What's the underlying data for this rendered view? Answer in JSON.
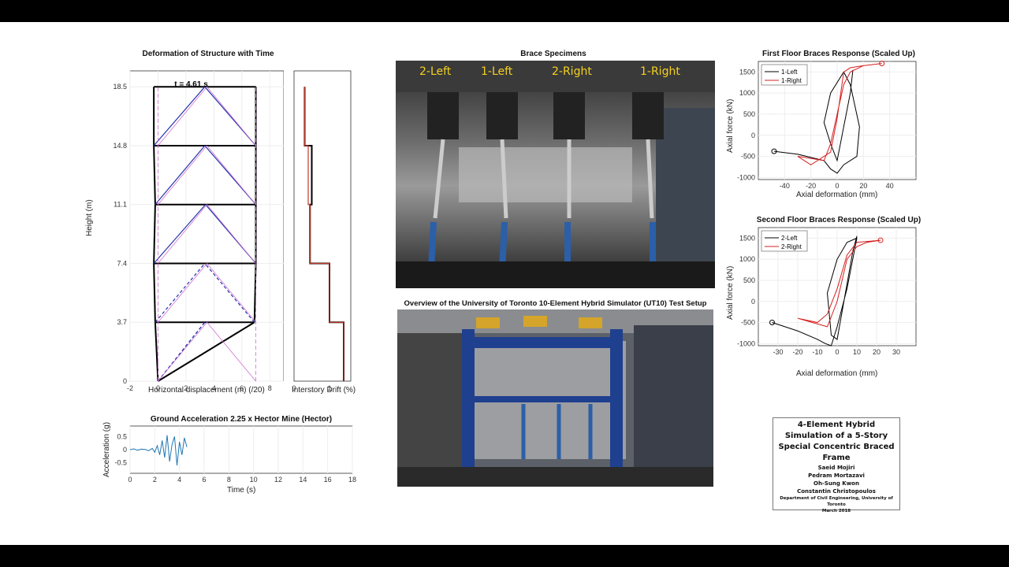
{
  "panels": {
    "deformation": {
      "title": "Deformation of Structure with Time",
      "time_label": "t =  4.61 s",
      "xlabel": "Horizontal displacement (m) (/20)",
      "ylabel": "Height (m)",
      "xticks": [
        "-2",
        "0",
        "2",
        "4",
        "6",
        "8"
      ],
      "yticks": [
        "0",
        "3.7",
        "7.4",
        "11.1",
        "14.8",
        "18.5"
      ]
    },
    "drift": {
      "xlabel": "Interstory Drift (%)",
      "xticks": [
        "0",
        "1"
      ]
    },
    "ground": {
      "title": "Ground Acceleration 2.25 x Hector Mine (Hector)",
      "xlabel": "Time (s)",
      "ylabel": "Acceleration (g)",
      "xticks": [
        "0",
        "2",
        "4",
        "6",
        "8",
        "10",
        "12",
        "14",
        "16",
        "18"
      ],
      "yticks": [
        "0.5",
        "0",
        "-0.5"
      ]
    },
    "brace_photo": {
      "title": "Brace Specimens",
      "labels": [
        "2-Left",
        "1-Left",
        "2-Right",
        "1-Right"
      ]
    },
    "setup_photo": {
      "title": "Overview of the University of Toronto 10-Element Hybrid Simulator (UT10) Test Setup"
    },
    "floor1": {
      "title": "First Floor Braces Response (Scaled Up)",
      "xlabel": "Axial deformation (mm)",
      "ylabel": "Axial force (kN)",
      "xticks": [
        "-40",
        "-20",
        "0",
        "20",
        "40"
      ],
      "yticks": [
        "1500",
        "1000",
        "500",
        "0",
        "-500",
        "-1000"
      ],
      "legend": [
        "1-Left",
        "1-Right"
      ]
    },
    "floor2": {
      "title": "Second Floor Braces Response (Scaled Up)",
      "xlabel": "Axial deformation (mm)",
      "ylabel": "Axial force (kN)",
      "xticks": [
        "-30",
        "-20",
        "-10",
        "0",
        "10",
        "20",
        "30"
      ],
      "yticks": [
        "1500",
        "1000",
        "500",
        "0",
        "-500",
        "-1000"
      ],
      "legend": [
        "2-Left",
        "2-Right"
      ]
    }
  },
  "credit": {
    "title": "4-Element Hybrid Simulation of a 5-Story Special Concentric Braced Frame",
    "authors": [
      "Saeid Mojiri",
      "Pedram Mortazavi",
      "Oh-Sung Kwon",
      "Constantin Christopoulos"
    ],
    "department": "Department of Civil Engineering, University of Toronto",
    "date": "March 2018"
  },
  "colors": {
    "left": "#000000",
    "right": "#d62020",
    "frame": "#000000",
    "brace": "#2233aa",
    "ghost": "#d070d0",
    "accel": "#1f77b4",
    "drift": "#c0392b"
  },
  "chart_data": [
    {
      "type": "line",
      "name": "deformation",
      "xlim": [
        -2,
        9
      ],
      "ylim": [
        0,
        19.5
      ],
      "story_heights": [
        0,
        3.7,
        7.4,
        11.1,
        14.8,
        18.5
      ],
      "floor_displacement": [
        0,
        6.9,
        7.0,
        7.0,
        7.0,
        7.0
      ],
      "floor_displacement_left": [
        0,
        -0.2,
        -0.3,
        -0.2,
        -0.3,
        -0.3
      ]
    },
    {
      "type": "line",
      "name": "drift",
      "xlim": [
        0,
        1.6
      ],
      "ylim": [
        0,
        19.5
      ],
      "current_drift": [
        1.4,
        1.0,
        0.45,
        0.4,
        0.3
      ],
      "peak_drift": [
        1.4,
        1.0,
        0.45,
        0.5,
        0.3
      ]
    },
    {
      "type": "line",
      "name": "ground",
      "xlim": [
        0,
        18
      ],
      "ylim": [
        -0.9,
        0.9
      ],
      "x": [
        0,
        0.3,
        0.6,
        0.9,
        1.2,
        1.5,
        1.8,
        2.0,
        2.2,
        2.4,
        2.6,
        2.8,
        3.0,
        3.2,
        3.4,
        3.6,
        3.8,
        4.0,
        4.2,
        4.4,
        4.6
      ],
      "y": [
        0.0,
        0.03,
        -0.02,
        0.02,
        0.01,
        -0.04,
        0.05,
        -0.1,
        0.15,
        -0.2,
        0.35,
        -0.3,
        0.55,
        -0.45,
        0.2,
        0.5,
        -0.6,
        0.3,
        -0.2,
        0.45,
        0.1
      ]
    },
    {
      "type": "scatter",
      "name": "floor1",
      "xlim": [
        -60,
        60
      ],
      "ylim": [
        -1050,
        1750
      ],
      "series": [
        {
          "name": "1-Left",
          "x": [
            -48,
            -30,
            -10,
            -5,
            0,
            5,
            15,
            17,
            10,
            5,
            -5,
            -10,
            -5,
            0,
            10,
            12
          ],
          "y": [
            -380,
            -450,
            -600,
            -800,
            -900,
            -700,
            -500,
            200,
            1200,
            1500,
            1000,
            300,
            -200,
            -600,
            1000,
            1550
          ]
        },
        {
          "name": "1-Right",
          "x": [
            34,
            20,
            10,
            5,
            0,
            -5,
            -20,
            -30,
            -10,
            -5,
            0,
            5,
            10,
            20,
            34
          ],
          "y": [
            1700,
            1650,
            1600,
            1500,
            400,
            -400,
            -700,
            -500,
            -600,
            -200,
            500,
            1200,
            1500,
            1650,
            1700
          ]
        }
      ]
    },
    {
      "type": "scatter",
      "name": "floor2",
      "xlim": [
        -40,
        40
      ],
      "ylim": [
        -1050,
        1750
      ],
      "series": [
        {
          "name": "2-Left",
          "x": [
            -33,
            -20,
            -10,
            -6,
            -3,
            0,
            5,
            10,
            5,
            0,
            -5,
            -3,
            0,
            8,
            10
          ],
          "y": [
            -500,
            -700,
            -900,
            -1000,
            -1050,
            -600,
            300,
            1500,
            1400,
            1000,
            200,
            -800,
            -900,
            1200,
            1550
          ]
        },
        {
          "name": "2-Right",
          "x": [
            22,
            15,
            10,
            5,
            0,
            -5,
            -20,
            -10,
            -5,
            0,
            5,
            10,
            22
          ],
          "y": [
            1450,
            1400,
            1300,
            1000,
            0,
            -600,
            -400,
            -500,
            -300,
            300,
            1100,
            1400,
            1450
          ]
        }
      ]
    }
  ]
}
